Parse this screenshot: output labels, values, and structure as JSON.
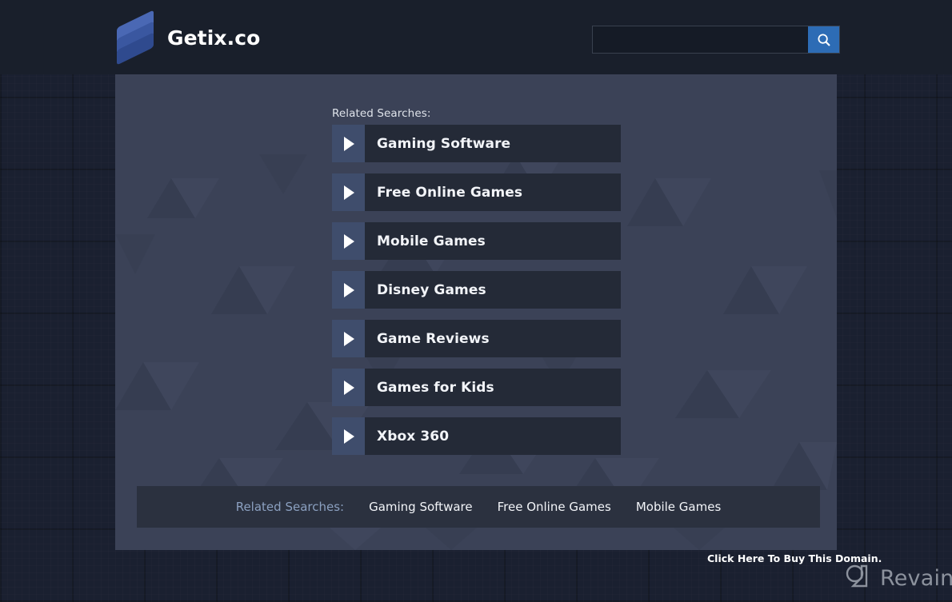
{
  "header": {
    "brand_name": "Getix.co",
    "logo_icon": "stacked-layers-icon",
    "search": {
      "value": "",
      "placeholder": "",
      "button_icon": "search-icon"
    }
  },
  "main": {
    "related_searches_label": "Related Searches:",
    "items": [
      {
        "label": "Gaming Software",
        "arrow_icon": "play-triangle-icon"
      },
      {
        "label": "Free Online Games",
        "arrow_icon": "play-triangle-icon"
      },
      {
        "label": "Mobile Games",
        "arrow_icon": "play-triangle-icon"
      },
      {
        "label": "Disney Games",
        "arrow_icon": "play-triangle-icon"
      },
      {
        "label": "Game Reviews",
        "arrow_icon": "play-triangle-icon"
      },
      {
        "label": "Games for Kids",
        "arrow_icon": "play-triangle-icon"
      },
      {
        "label": "Xbox 360",
        "arrow_icon": "play-triangle-icon"
      }
    ]
  },
  "footer_bar": {
    "label": "Related Searches:",
    "links": [
      "Gaming Software",
      "Free Online Games",
      "Mobile Games"
    ]
  },
  "buy_domain": {
    "text": "Click Here To Buy This Domain."
  },
  "watermark": {
    "text": "Revain",
    "icon": "revain-logo-icon"
  },
  "colors": {
    "page_background": "#1a2030",
    "header_background": "#191f2b",
    "panel_background": "#3b4257",
    "item_box": "#242a37",
    "item_arrow_box": "#3f4d6c",
    "accent_blue": "#2d6cb5",
    "footer_bar": "#2b313f",
    "muted_text": "#8ba0c0",
    "text_light": "#f2f4f8"
  }
}
